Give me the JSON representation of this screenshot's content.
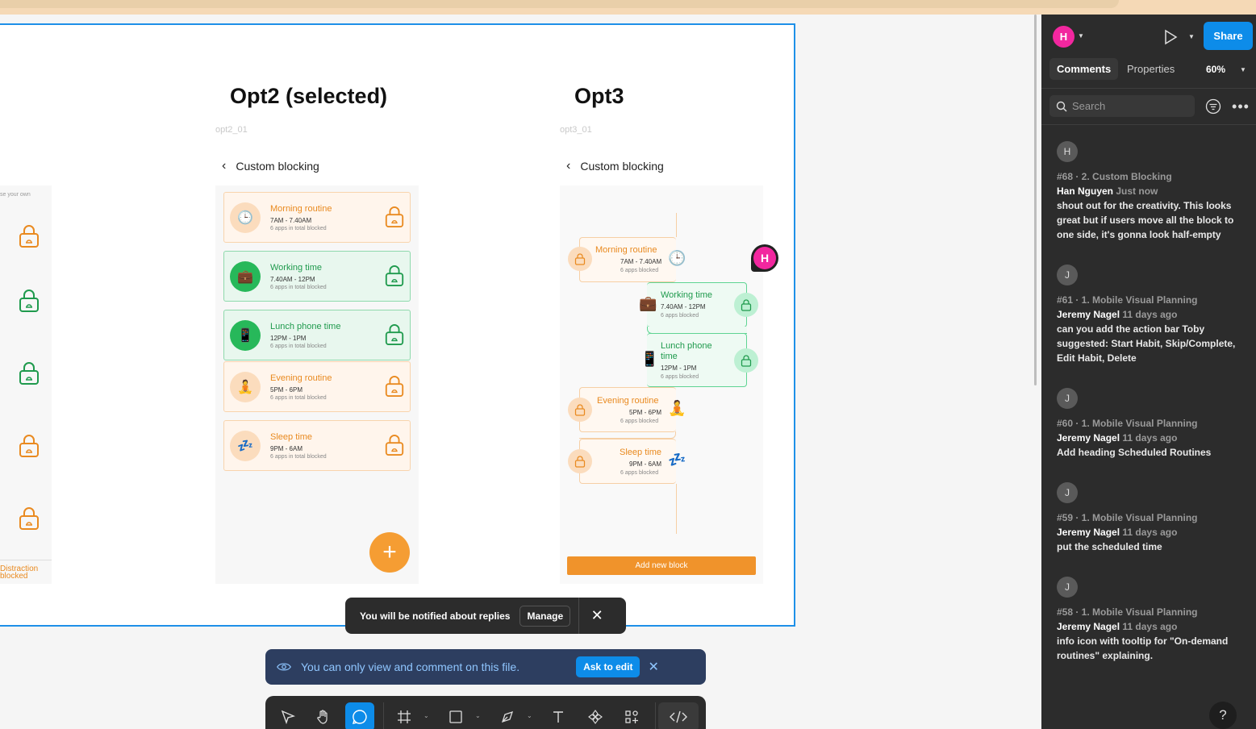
{
  "frames": {
    "opt2": {
      "title": "Opt2 (selected)",
      "subtitle": "opt2_01",
      "header": "Custom blocking"
    },
    "opt3": {
      "title": "Opt3",
      "subtitle": "opt3_01",
      "header": "Custom blocking"
    },
    "opt1": {
      "partial_label": "se your own",
      "footer_line1": "Distraction",
      "footer_line2": "blocked"
    }
  },
  "opt2_cards": [
    {
      "name": "Morning routine",
      "time": "7AM - 7.40AM",
      "apps": "6 apps in total blocked",
      "icon": "clock-icon",
      "glyph": "🕒",
      "style": "orange"
    },
    {
      "name": "Working time",
      "time": "7.40AM - 12PM",
      "apps": "6 apps in total blocked",
      "icon": "briefcase-icon",
      "glyph": "💼",
      "style": "green"
    },
    {
      "name": "Lunch phone time",
      "time": "12PM - 1PM",
      "apps": "6 apps in total blocked",
      "icon": "phone-icon",
      "glyph": "📱",
      "style": "green"
    },
    {
      "name": "Evening routine",
      "time": "5PM - 6PM",
      "apps": "6 apps in total blocked",
      "icon": "meditation-icon",
      "glyph": "🧘",
      "style": "orange"
    },
    {
      "name": "Sleep time",
      "time": "9PM - 6AM",
      "apps": "6 apps in total blocked",
      "icon": "sleep-icon",
      "glyph": "💤",
      "style": "orange"
    }
  ],
  "opt3_blocks": [
    {
      "name": "Morning routine",
      "time": "7AM - 7.40AM",
      "apps": "6 apps blocked",
      "glyph": "🕒"
    },
    {
      "name": "Working time",
      "time": "7.40AM - 12PM",
      "apps": "6 apps blocked",
      "glyph": "💼"
    },
    {
      "name_line1": "Lunch phone",
      "name_line2": "time",
      "time": "12PM - 1PM",
      "apps": "6 apps blocked",
      "glyph": "📱"
    },
    {
      "name": "Evening routine",
      "time": "5PM - 6PM",
      "apps": "6 apps blocked",
      "glyph": "🧘"
    },
    {
      "name": "Sleep time",
      "time": "9PM - 6AM",
      "apps": "6 apps blocked",
      "glyph": "💤"
    }
  ],
  "add_block_label": "Add new block",
  "fab_label": "+",
  "canvas_avatar": "H",
  "toast": {
    "message": "You will be notified about replies",
    "manage": "Manage",
    "close": "✕"
  },
  "view_banner": {
    "message": "You can only view and comment on this file.",
    "ask": "Ask to edit",
    "close": "✕"
  },
  "panel": {
    "avatar": "H",
    "share": "Share",
    "tabs": [
      "Comments",
      "Properties"
    ],
    "zoom": "60%",
    "search_placeholder": "Search",
    "help": "?",
    "comments": [
      {
        "avatar": "H",
        "ref": "#68 · 2. Custom Blocking",
        "author": "Han Nguyen",
        "when": "Just now",
        "text": "shout out for the creativity. This looks great but if users move all the block to one side, it's gonna look half-empty"
      },
      {
        "avatar": "J",
        "ref": "#61 · 1. Mobile Visual Planning",
        "author": "Jeremy Nagel",
        "when": "11 days ago",
        "text": "can you add the action bar Toby suggested: Start Habit, Skip/Complete, Edit Habit, Delete"
      },
      {
        "avatar": "J",
        "ref": "#60 · 1. Mobile Visual Planning",
        "author": "Jeremy Nagel",
        "when": "11 days ago",
        "text": "Add heading Scheduled Routines"
      },
      {
        "avatar": "J",
        "ref": "#59 · 1. Mobile Visual Planning",
        "author": "Jeremy Nagel",
        "when": "11 days ago",
        "text": "put the scheduled time"
      },
      {
        "avatar": "J",
        "ref": "#58 · 1. Mobile Visual Planning",
        "author": "Jeremy Nagel",
        "when": "11 days ago",
        "text": "info icon with tooltip for \"On-demand routines\" explaining."
      }
    ]
  },
  "colors": {
    "orange": "#e98a20",
    "green": "#1f9a4d",
    "accent": "#0d8ce9",
    "brand_pink": "#f2279f"
  }
}
